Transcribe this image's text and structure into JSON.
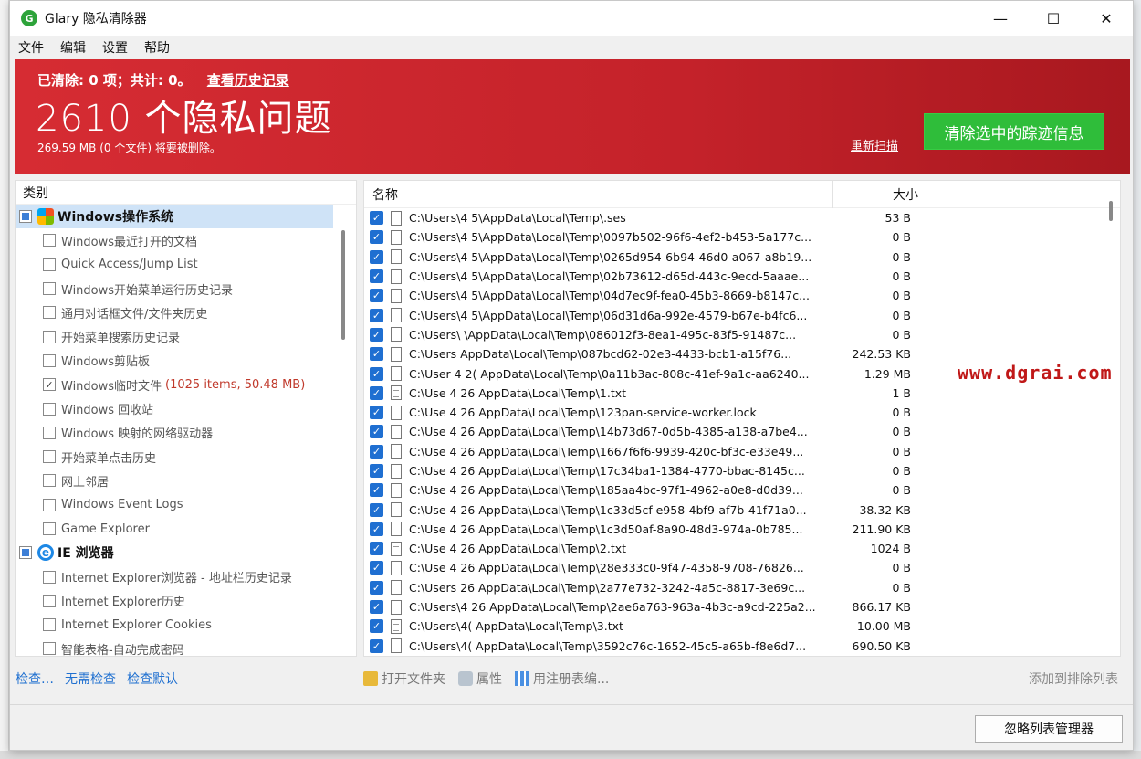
{
  "window": {
    "title": "Glary 隐私清除器",
    "controls": {
      "minimize": "—",
      "maximize": "☐",
      "close": "✕"
    }
  },
  "menu": [
    "文件",
    "编辑",
    "设置",
    "帮助"
  ],
  "banner": {
    "summary": "已清除: 0 项；共计: 0。",
    "history_link": "查看历史记录",
    "big_title": "2610 个隐私问题",
    "subtitle": "269.59 MB (0 个文件) 将要被删除。",
    "rescan": "重新扫描",
    "clean_button": "清除选中的踪迹信息"
  },
  "categories": {
    "header": "类别",
    "groups": [
      {
        "label": "Windows操作系统",
        "icon": "windows-logo-icon",
        "items": [
          {
            "label": "Windows最近打开的文档",
            "checked": false
          },
          {
            "label": "Quick Access/Jump List",
            "checked": false
          },
          {
            "label": "Windows开始菜单运行历史记录",
            "checked": false
          },
          {
            "label": "通用对话框文件/文件夹历史",
            "checked": false
          },
          {
            "label": "开始菜单搜索历史记录",
            "checked": false
          },
          {
            "label": "Windows剪贴板",
            "checked": false
          },
          {
            "label": "Windows临时文件",
            "checked": true,
            "info": "(1025 items, 50.48 MB)"
          },
          {
            "label": "Windows 回收站",
            "checked": false
          },
          {
            "label": "Windows 映射的网络驱动器",
            "checked": false
          },
          {
            "label": "开始菜单点击历史",
            "checked": false
          },
          {
            "label": "网上邻居",
            "checked": false
          },
          {
            "label": "Windows Event Logs",
            "checked": false
          },
          {
            "label": "Game Explorer",
            "checked": false
          }
        ]
      },
      {
        "label": "IE 浏览器",
        "icon": "internet-explorer-icon",
        "items": [
          {
            "label": "Internet Explorer浏览器 - 地址栏历史记录",
            "checked": false
          },
          {
            "label": "Internet Explorer历史",
            "checked": false
          },
          {
            "label": "Internet Explorer Cookies",
            "checked": false
          },
          {
            "label": "智能表格-自动完成密码",
            "checked": false
          }
        ]
      }
    ],
    "links": [
      "检查…",
      "无需检查",
      "检查默认"
    ]
  },
  "files": {
    "columns": [
      "名称",
      "大小"
    ],
    "rows": [
      {
        "name": "C:\\Users\\4     5\\AppData\\Local\\Temp\\.ses",
        "size": "53 B",
        "type": "file"
      },
      {
        "name": "C:\\Users\\4     5\\AppData\\Local\\Temp\\0097b502-96f6-4ef2-b453-5a177c...",
        "size": "0 B",
        "type": "file"
      },
      {
        "name": "C:\\Users\\4     5\\AppData\\Local\\Temp\\0265d954-6b94-46d0-a067-a8b19...",
        "size": "0 B",
        "type": "file"
      },
      {
        "name": "C:\\Users\\4     5\\AppData\\Local\\Temp\\02b73612-d65d-443c-9ecd-5aaae...",
        "size": "0 B",
        "type": "file"
      },
      {
        "name": "C:\\Users\\4     5\\AppData\\Local\\Temp\\04d7ec9f-fea0-45b3-8669-b8147c...",
        "size": "0 B",
        "type": "file"
      },
      {
        "name": "C:\\Users\\4     5\\AppData\\Local\\Temp\\06d31d6a-992e-4579-b67e-b4fc6...",
        "size": "0 B",
        "type": "file"
      },
      {
        "name": "C:\\Users\\     \\AppData\\Local\\Temp\\086012f3-8ea1-495c-83f5-91487c...",
        "size": "0 B",
        "type": "file"
      },
      {
        "name": "C:\\Users     AppData\\Local\\Temp\\087bcd62-02e3-4433-bcb1-a15f76...",
        "size": "242.53 KB",
        "type": "file"
      },
      {
        "name": "C:\\User  4  2(  AppData\\Local\\Temp\\0a11b3ac-808c-41ef-9a1c-aa6240...",
        "size": "1.29 MB",
        "type": "file"
      },
      {
        "name": "C:\\Use   4  26  AppData\\Local\\Temp\\1.txt",
        "size": "1 B",
        "type": "txt"
      },
      {
        "name": "C:\\Use   4  26  AppData\\Local\\Temp\\123pan-service-worker.lock",
        "size": "0 B",
        "type": "file"
      },
      {
        "name": "C:\\Use   4  26  AppData\\Local\\Temp\\14b73d67-0d5b-4385-a138-a7be4...",
        "size": "0 B",
        "type": "file"
      },
      {
        "name": "C:\\Use   4  26  AppData\\Local\\Temp\\1667f6f6-9939-420c-bf3c-e33e49...",
        "size": "0 B",
        "type": "file"
      },
      {
        "name": "C:\\Use   4  26  AppData\\Local\\Temp\\17c34ba1-1384-4770-bbac-8145c...",
        "size": "0 B",
        "type": "file"
      },
      {
        "name": "C:\\Use   4  26  AppData\\Local\\Temp\\185aa4bc-97f1-4962-a0e8-d0d39...",
        "size": "0 B",
        "type": "file"
      },
      {
        "name": "C:\\Use   4  26  AppData\\Local\\Temp\\1c33d5cf-e958-4bf9-af7b-41f71a0...",
        "size": "38.32 KB",
        "type": "file"
      },
      {
        "name": "C:\\Use   4  26  AppData\\Local\\Temp\\1c3d50af-8a90-48d3-974a-0b785...",
        "size": "211.90 KB",
        "type": "file"
      },
      {
        "name": "C:\\Use   4  26  AppData\\Local\\Temp\\2.txt",
        "size": "1024 B",
        "type": "txt"
      },
      {
        "name": "C:\\Use   4  26  AppData\\Local\\Temp\\28e333c0-9f47-4358-9708-76826...",
        "size": "0 B",
        "type": "file"
      },
      {
        "name": "C:\\Users     26  AppData\\Local\\Temp\\2a77e732-3242-4a5c-8817-3e69c...",
        "size": "0 B",
        "type": "file"
      },
      {
        "name": "C:\\Users\\4     26  AppData\\Local\\Temp\\2ae6a763-963a-4b3c-a9cd-225a2...",
        "size": "866.17 KB",
        "type": "file"
      },
      {
        "name": "C:\\Users\\4(     AppData\\Local\\Temp\\3.txt",
        "size": "10.00 MB",
        "type": "txt"
      },
      {
        "name": "C:\\Users\\4(     AppData\\Local\\Temp\\3592c76c-1652-45c5-a65b-f8e6d7...",
        "size": "690.50 KB",
        "type": "file"
      }
    ]
  },
  "toolbar": {
    "open_folder": "打开文件夹",
    "properties": "属性",
    "registry": "用注册表编...",
    "add_exclude": "添加到排除列表"
  },
  "bottom": {
    "ignore_manager": "忽略列表管理器"
  },
  "watermark": "www.dgrai.com",
  "colors": {
    "banner_red": "#c4222a",
    "clean_green": "#2fbd3a",
    "checkbox_blue": "#1f6fd1",
    "link_blue": "#1e6fd0"
  }
}
